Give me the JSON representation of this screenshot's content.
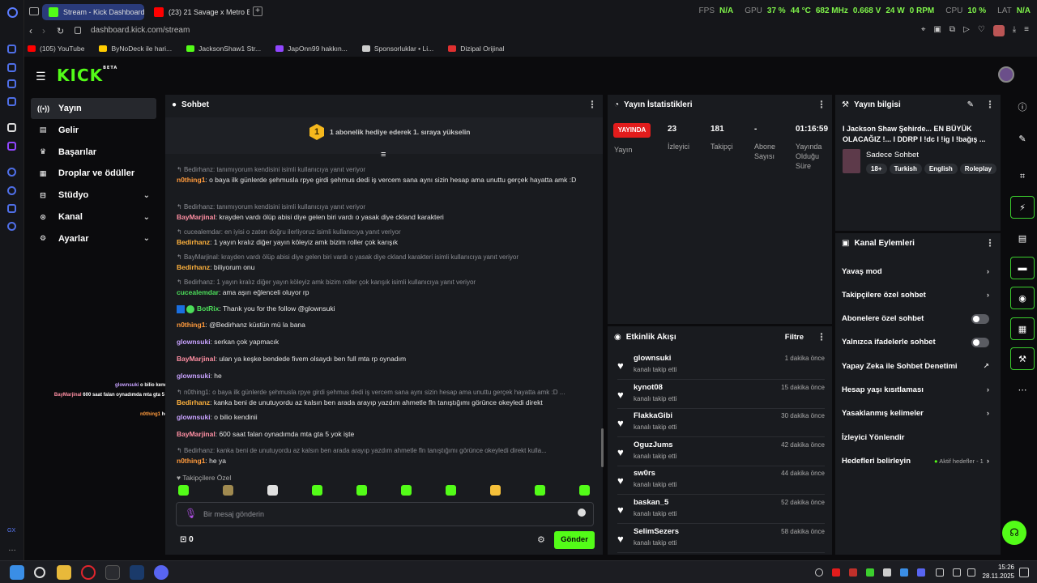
{
  "browser": {
    "tabs": [
      {
        "label": "Stream - Kick Dashboard"
      },
      {
        "label": "(23) 21 Savage x Metro B"
      }
    ],
    "url": "dashboard.kick.com/stream",
    "hud": {
      "fps_label": "FPS",
      "fps": "N/A",
      "gpu_label": "GPU",
      "gpu_load": "37 %",
      "gpu_temp": "44 °C",
      "gpu_clock": "682 MHz",
      "gpu_volt": "0.668 V",
      "gpu_power": "24 W",
      "gpu_rpm": "0 RPM",
      "cpu_label": "CPU",
      "cpu_load": "10 %",
      "lat_label": "LAT",
      "lat": "N/A"
    },
    "bookmarks": [
      {
        "label": "(105) YouTube",
        "color": "#ff0000"
      },
      {
        "label": "ByNoDeck ile hari...",
        "color": "#ffcc00"
      },
      {
        "label": "JacksonShaw1 Str...",
        "color": "#53fc18"
      },
      {
        "label": "JapOnn99 hakkın...",
        "color": "#9146ff"
      },
      {
        "label": "Sponsorluklar • Li...",
        "color": "#cccccc"
      },
      {
        "label": "Dizipal Orijinal",
        "color": "#e03030"
      }
    ]
  },
  "sidebar": {
    "logo": "KICK",
    "beta": "BETA",
    "items": [
      {
        "label": "Yayın"
      },
      {
        "label": "Gelir"
      },
      {
        "label": "Başarılar"
      },
      {
        "label": "Droplar ve ödüller"
      },
      {
        "label": "Stüdyo"
      },
      {
        "label": "Kanal"
      },
      {
        "label": "Ayarlar"
      }
    ]
  },
  "overlay": [
    {
      "user": "glownsuki",
      "text": " o bilio kendinii"
    },
    {
      "user": "BayMarjinal",
      "text": " 600 saat falan oynadımda mta gta 5 yok işte"
    },
    {
      "user": "n0thing1",
      "text": " he ya"
    }
  ],
  "chat": {
    "title": "Sohbet",
    "gift_banner": "1 abonelik hediye ederek 1. sıraya yükselin",
    "gift_rank": "1",
    "messages": [
      {
        "reply": "Bedirhanz: tanımıyorum kendisini isimli kullanıcıya yanıt veriyor",
        "user": "n0thing1",
        "color": "c-org",
        "text": " o baya ilk günlerde şehmusla rpye girdi şehmus dedi iş vercem sana aynı sizin hesap ama unuttu gerçek hayatta amk :D"
      },
      {
        "reply": "Bedirhanz: tanımıyorum kendisini isimli kullanıcıya yanıt veriyor",
        "user": "BayMarjinal",
        "color": "c-pink",
        "text": " krayden vardı ölüp abisi diye gelen biri vardı o yasak diye ckland karakteri"
      },
      {
        "reply": "cucealemdar: en iyisi o zaten doğru ilerliyoruz isimli kullanıcıya yanıt veriyor",
        "user": "Bedirhanz",
        "color": "c-yel",
        "text": " 1 yayın kralız diğer yayın köleyiz amk bizim roller çok karışık"
      },
      {
        "reply": "BayMarjinal: krayden vardı ölüp abisi diye gelen biri vardı o yasak diye ckland karakteri isimli kullanıcıya yanıt veriyor",
        "user": "Bedirhanz",
        "color": "c-yel",
        "text": " biliyorum onu"
      },
      {
        "reply": "Bedirhanz: 1 yayın kralız diğer yayın köleyiz amk bizim roller çok karışık isimli kullanıcıya yanıt veriyor",
        "user": "cucealemdar",
        "color": "c-grn",
        "text": " ama aşırı eğlenceli oluyor rp"
      },
      {
        "reply": "",
        "user": "BotRix",
        "color": "c-grn",
        "text": " Thank you for the follow @glownsuki"
      },
      {
        "reply": "",
        "user": "n0thing1",
        "color": "c-org",
        "text": " @Bedirhanz küstün mü la bana"
      },
      {
        "reply": "",
        "user": "glownsuki",
        "color": "c-pur",
        "text": " serkan çok yapmacık"
      },
      {
        "reply": "",
        "user": "BayMarjinal",
        "color": "c-pink",
        "text": " ulan ya keşke bendede fivem olsaydı ben full mta rp oynadım"
      },
      {
        "reply": "",
        "user": "glownsuki",
        "color": "c-pur",
        "text": " he"
      },
      {
        "reply": "n0thing1: o baya ilk günlerde şehmusla rpye girdi şehmus dedi iş vercem sana aynı sizin hesap ama unuttu gerçek hayatta amk :D ...",
        "user": "Bedirhanz",
        "color": "c-yel",
        "text": " kanka beni de unutuyordu az kalsın ben arada arayıp yazdım ahmetle fln tanıştığımı görünce okeyledi direkt"
      },
      {
        "reply": "",
        "user": "glownsuki",
        "color": "c-pur",
        "text": " o bilio kendinii"
      },
      {
        "reply": "",
        "user": "BayMarjinal",
        "color": "c-pink",
        "text": " 600 saat falan oynadımda mta gta 5 yok işte"
      },
      {
        "reply": "Bedirhanz: kanka beni de unutuyordu az kalsın ben arada arayıp yazdım ahmetle fln tanıştığımı görünce okeyledi direkt kulla...",
        "user": "n0thing1",
        "color": "c-org",
        "text": " he ya"
      }
    ],
    "followers_only": "Takipçilere Özel",
    "input_placeholder": "Bir mesaj gönderin",
    "points": "0",
    "send_label": "Gönder"
  },
  "stats": {
    "title": "Yayın İstatistikleri",
    "live_badge": "YAYINDA",
    "items": [
      {
        "value": "",
        "label": "Yayın"
      },
      {
        "value": "23",
        "label": "İzleyici"
      },
      {
        "value": "181",
        "label": "Takipçi"
      },
      {
        "value": "-",
        "label": "Abone Sayısı"
      },
      {
        "value": "01:16:59",
        "label": "Yayında Olduğu Süre"
      }
    ]
  },
  "activity": {
    "title": "Etkinlik Akışı",
    "filter": "Filtre",
    "items": [
      {
        "user": "glownsuki",
        "sub": "kanalı takip etti",
        "time": "1 dakika önce"
      },
      {
        "user": "kynot08",
        "sub": "kanalı takip etti",
        "time": "15 dakika önce"
      },
      {
        "user": "FlakkaGibi",
        "sub": "kanalı takip etti",
        "time": "30 dakika önce"
      },
      {
        "user": "OguzJums",
        "sub": "kanalı takip etti",
        "time": "42 dakika önce"
      },
      {
        "user": "sw0rs",
        "sub": "kanalı takip etti",
        "time": "44 dakika önce"
      },
      {
        "user": "baskan_5",
        "sub": "kanalı takip etti",
        "time": "52 dakika önce"
      },
      {
        "user": "SelimSezers",
        "sub": "kanalı takip etti",
        "time": "58 dakika önce"
      }
    ]
  },
  "info": {
    "title": "Yayın bilgisi",
    "stream_title": "I Jackson Shaw Şehirde... EN BÜYÜK OLACAĞIZ !... I DDRP I !dc I !ig I !bağış ...",
    "category": "Sadece Sohbet",
    "tags": [
      "18+",
      "Turkish",
      "English",
      "Roleplay"
    ]
  },
  "channel": {
    "title": "Kanal Eylemleri",
    "actions": [
      {
        "label": "Yavaş mod",
        "kind": "arrow"
      },
      {
        "label": "Takipçilere özel sohbet",
        "kind": "arrow"
      },
      {
        "label": "Abonelere özel sohbet",
        "kind": "toggle"
      },
      {
        "label": "Yalnızca ifadelerle sohbet",
        "kind": "toggle"
      },
      {
        "label": "Yapay Zeka ile Sohbet Denetimi",
        "kind": "ext"
      },
      {
        "label": "Hesap yaşı kısıtlaması",
        "kind": "arrow"
      },
      {
        "label": "Yasaklanmış kelimeler",
        "kind": "arrow"
      },
      {
        "label": "İzleyici Yönlendir",
        "kind": "none"
      },
      {
        "label": "Hedefleri belirleyin",
        "kind": "goal"
      }
    ],
    "goal_status": "Aktif hedefler - 1"
  },
  "taskbar": {
    "time": "15:26",
    "date": "28.11.2025"
  },
  "colors": {
    "accent": "#53fc18",
    "live": "#e31c1c",
    "panel": "#191b1f"
  }
}
